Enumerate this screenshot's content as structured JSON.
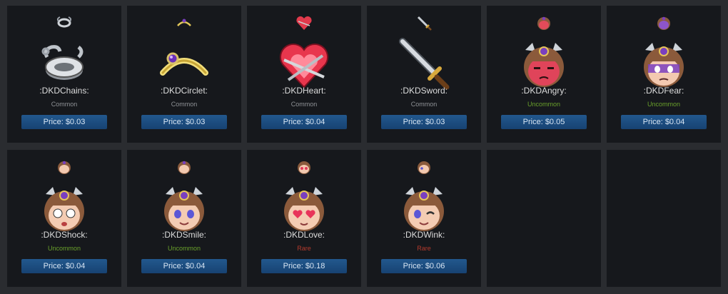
{
  "rarity_colors": {
    "Common": "#8f9296",
    "Uncommon": "#6aa12b",
    "Rare": "#b53a2d"
  },
  "items": [
    {
      "name": ":DKDChains:",
      "rarity": "Common",
      "price": "Price: $0.03",
      "icon": "chains-icon"
    },
    {
      "name": ":DKDCirclet:",
      "rarity": "Common",
      "price": "Price: $0.03",
      "icon": "circlet-icon"
    },
    {
      "name": ":DKDHeart:",
      "rarity": "Common",
      "price": "Price: $0.04",
      "icon": "heart-icon"
    },
    {
      "name": ":DKDSword:",
      "rarity": "Common",
      "price": "Price: $0.03",
      "icon": "sword-icon"
    },
    {
      "name": ":DKDAngry:",
      "rarity": "Uncommon",
      "price": "Price: $0.05",
      "icon": "angry-face-icon"
    },
    {
      "name": ":DKDFear:",
      "rarity": "Uncommon",
      "price": "Price: $0.04",
      "icon": "fear-face-icon"
    },
    {
      "name": ":DKDShock:",
      "rarity": "Uncommon",
      "price": "Price: $0.04",
      "icon": "shock-face-icon"
    },
    {
      "name": ":DKDSmile:",
      "rarity": "Uncommon",
      "price": "Price: $0.04",
      "icon": "smile-face-icon"
    },
    {
      "name": ":DKDLove:",
      "rarity": "Rare",
      "price": "Price: $0.18",
      "icon": "love-face-icon"
    },
    {
      "name": ":DKDWink:",
      "rarity": "Rare",
      "price": "Price: $0.06",
      "icon": "wink-face-icon"
    }
  ]
}
